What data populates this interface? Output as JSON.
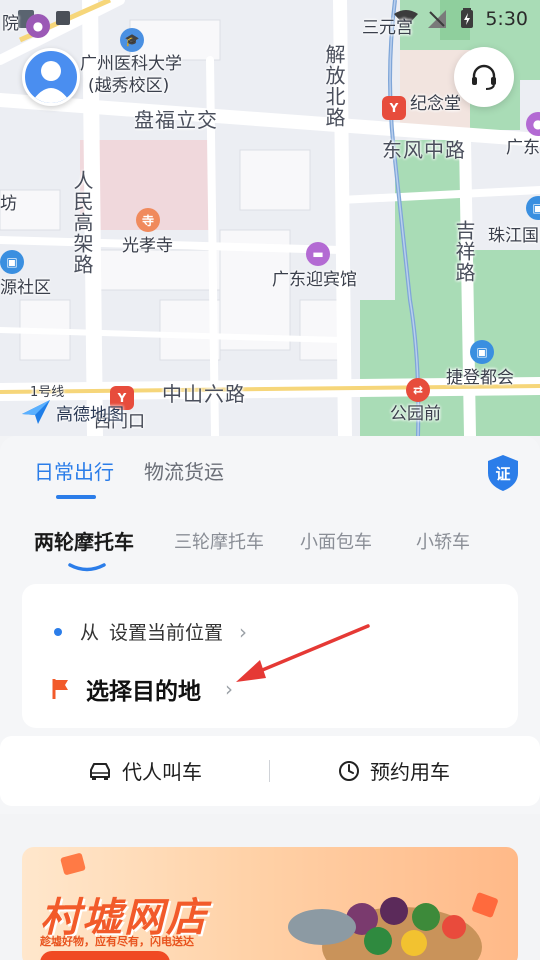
{
  "status_bar": {
    "time": "5:30"
  },
  "map": {
    "labels": {
      "gzmu": "广州医科大学",
      "gzmu_sub": "(越秀校区)",
      "panfu": "盘福立交",
      "jiefang": "解放北路",
      "jinian": "纪念堂",
      "dongfeng": "东风中路",
      "guangdong_right": "广东",
      "renmin": "人民高架路",
      "guangxiao": "光孝寺",
      "yingbin": "广东迎宾馆",
      "jixiang": "吉祥路",
      "zhujiang": "珠江国",
      "zhongshan": "中山六路",
      "jiedeng": "捷登都会",
      "gongyuanqian": "公园前",
      "ximenkou": "西门口",
      "sanyuan": "三元宫",
      "yuan": "院",
      "fang": "坊",
      "yuan_shequ": "源社区",
      "line1": "1号线",
      "logo": "高德地图"
    }
  },
  "tabs_main": [
    {
      "label": "日常出行",
      "active": true
    },
    {
      "label": "物流货运",
      "active": false
    }
  ],
  "cert_label": "证",
  "tabs_sub": [
    {
      "label": "两轮摩托车",
      "active": true
    },
    {
      "label": "三轮摩托车",
      "active": false
    },
    {
      "label": "小面包车",
      "active": false
    },
    {
      "label": "小轿车",
      "active": false
    }
  ],
  "trip": {
    "from_prefix": "从",
    "from_text": "设置当前位置",
    "to_text": "选择目的地"
  },
  "actions": {
    "proxy_call": "代人叫车",
    "reserve": "预约用车"
  },
  "banner": {
    "title": "村墟网店",
    "subtitle": "趁墟好物，应有尽有，闪电送达"
  },
  "colors": {
    "accent": "#2b7de9",
    "flag": "#f25a2a",
    "arrow": "#e53935"
  }
}
